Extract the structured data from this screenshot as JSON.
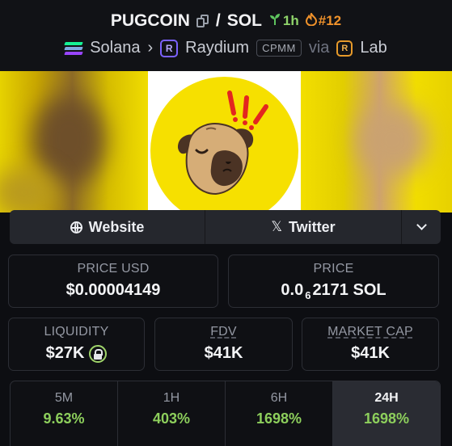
{
  "header": {
    "token_symbol": "PUGCOIN",
    "separator": "/",
    "quote_symbol": "SOL",
    "age": "1h",
    "rank": "#12",
    "chain": "Solana",
    "dex": "Raydium",
    "pool_type": "CPMM",
    "via": "via",
    "launchpad": "Lab",
    "icons": [
      "copy-icon",
      "sprout-icon",
      "flame-icon",
      "solana-logo",
      "raydium-logo",
      "lab-logo"
    ],
    "colors": {
      "age": "#8fd36a",
      "rank": "#f0922b",
      "raydium": "#7b61ff",
      "lab": "#e79a2a"
    }
  },
  "links": {
    "website_label": "Website",
    "twitter_label": "Twitter",
    "more_icon": "chevron-down-icon"
  },
  "stats": {
    "price_usd_label": "PRICE USD",
    "price_usd": "$0.00004149",
    "price_label": "PRICE",
    "price_sol_lead": "0.0",
    "price_sol_zeros": "6",
    "price_sol_tail": "2171 SOL",
    "liquidity_label": "LIQUIDITY",
    "liquidity": "$27K",
    "fdv_label": "FDV",
    "fdv": "$41K",
    "mcap_label": "MARKET CAP",
    "mcap": "$41K"
  },
  "changes": [
    {
      "label": "5M",
      "value": "9.63%"
    },
    {
      "label": "1H",
      "value": "403%"
    },
    {
      "label": "6H",
      "value": "1698%"
    },
    {
      "label": "24H",
      "value": "1698%",
      "active": true
    }
  ],
  "accent_green": "#8dcf5c"
}
